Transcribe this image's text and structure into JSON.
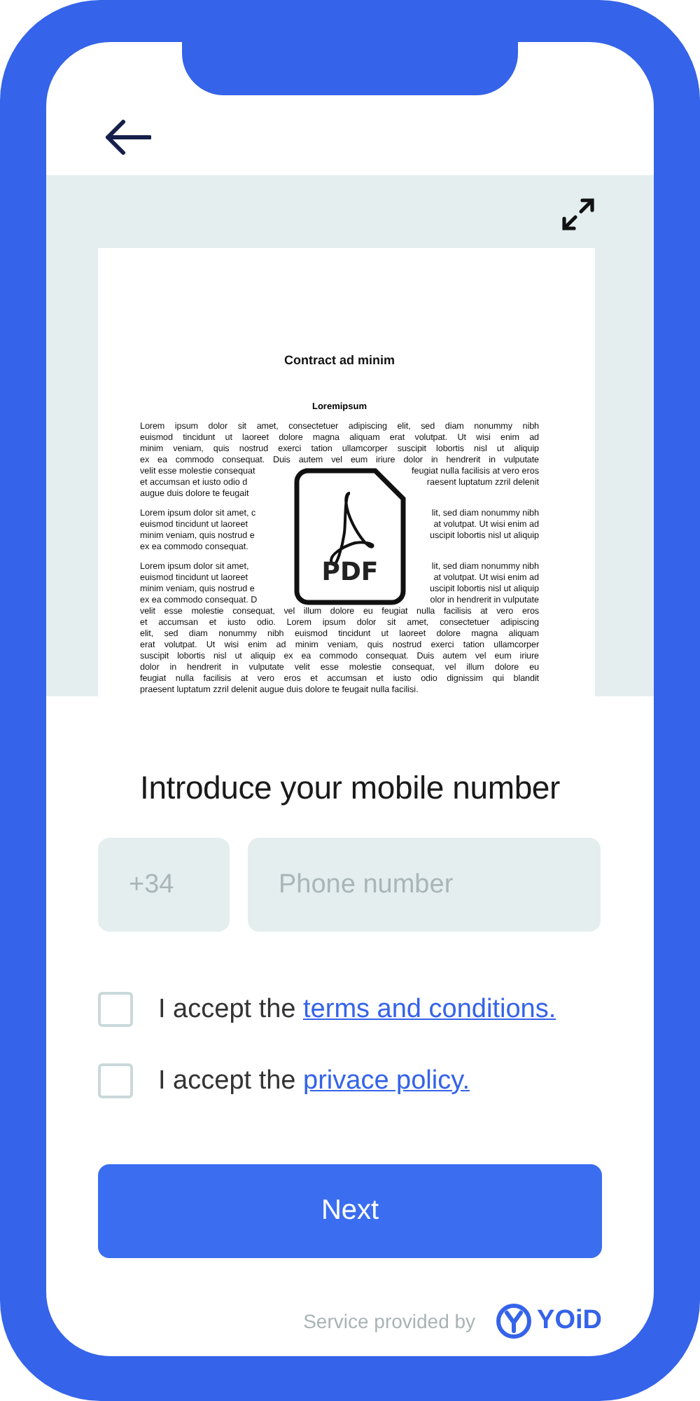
{
  "document": {
    "title": "Contract ad minim",
    "subtitle": "Loremipsum",
    "paragraphs": [
      [
        {
          "kind": "full",
          "text": "Lorem ipsum dolor sit amet, consectetuer adipiscing elit, sed diam nonummy nibh"
        },
        {
          "kind": "full",
          "text": "euismod tincidunt ut laoreet dolore magna aliquam erat volutpat. Ut wisi enim ad"
        },
        {
          "kind": "full",
          "text": "minim veniam, quis nostrud exerci tation ullamcorper suscipit lobortis nisl ut aliquip"
        },
        {
          "kind": "full",
          "text": "ex ea commodo consequat. Duis autem vel eum iriure dolor in hendrerit in vulputate"
        },
        {
          "kind": "split",
          "left": "velit esse molestie consequat",
          "right": "feugiat nulla facilisis at vero eros"
        },
        {
          "kind": "split",
          "left": "et accumsan et iusto odio d",
          "right": "raesent luptatum zzril delenit"
        },
        {
          "kind": "end",
          "text": "augue duis dolore te feugait"
        }
      ],
      [
        {
          "kind": "split",
          "left": "Lorem ipsum dolor sit amet, c",
          "right": "lit, sed diam nonummy nibh"
        },
        {
          "kind": "split",
          "left": "euismod tincidunt ut laoreet",
          "right": "at volutpat. Ut wisi enim ad"
        },
        {
          "kind": "split",
          "left": "minim veniam, quis nostrud e",
          "right": "uscipit lobortis nisl ut aliquip"
        },
        {
          "kind": "end",
          "text": "ex ea commodo consequat."
        }
      ],
      [
        {
          "kind": "split",
          "left": "Lorem ipsum dolor sit amet,",
          "right": "lit, sed diam nonummy nibh"
        },
        {
          "kind": "split",
          "left": "euismod tincidunt ut laoreet",
          "right": "at volutpat. Ut wisi enim ad"
        },
        {
          "kind": "split",
          "left": "minim veniam, quis nostrud e",
          "right": "uscipit lobortis nisl ut aliquip"
        },
        {
          "kind": "split",
          "left": "ex ea commodo consequat. D",
          "right": "olor in hendrerit in vulputate"
        },
        {
          "kind": "full",
          "text": "velit esse molestie consequat, vel illum dolore eu feugiat nulla facilisis at vero eros"
        },
        {
          "kind": "full",
          "text": "et accumsan et iusto odio. Lorem ipsum dolor sit amet, consectetuer adipiscing"
        },
        {
          "kind": "full",
          "text": "elit, sed diam nonummy nibh euismod tincidunt ut laoreet dolore magna aliquam"
        },
        {
          "kind": "full",
          "text": "erat volutpat. Ut wisi enim ad minim veniam, quis nostrud exerci tation ullamcorper"
        },
        {
          "kind": "full",
          "text": "suscipit lobortis nisl ut aliquip ex ea commodo consequat. Duis autem vel eum iriure"
        },
        {
          "kind": "full",
          "text": "dolor in hendrerit in vulputate velit esse molestie consequat, vel illum dolore eu"
        },
        {
          "kind": "full",
          "text": "feugiat nulla facilisis at vero eros et accumsan et iusto odio dignissim qui blandit"
        },
        {
          "kind": "end",
          "text": "praesent luptatum zzril delenit augue duis dolore te feugait nulla facilisi."
        }
      ]
    ],
    "file_badge": "PDF"
  },
  "heading": "Introduce your mobile number",
  "prefix_field": {
    "placeholder": "+34"
  },
  "phone_field": {
    "placeholder": "Phone number"
  },
  "consents": [
    {
      "prefix": "I accept the",
      "link": "terms and conditions.",
      "checked": false
    },
    {
      "prefix": "I accept the",
      "link": "privace policy.",
      "checked": false
    }
  ],
  "next_button": "Next",
  "footer": {
    "text": "Service provided by",
    "brand": "YOiD"
  }
}
